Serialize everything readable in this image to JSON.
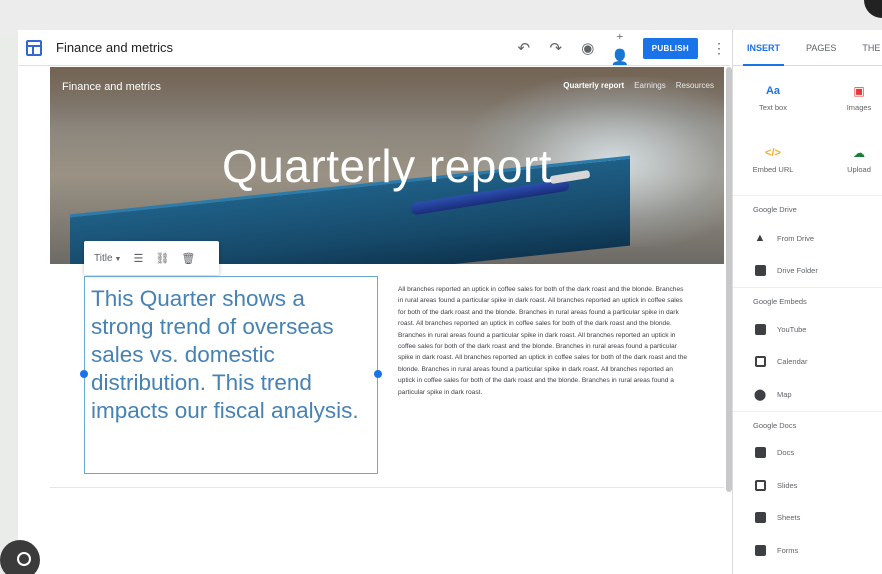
{
  "app": {
    "doc_title": "Finance and metrics",
    "publish_label": "PUBLISH"
  },
  "hero": {
    "site_title": "Finance and metrics",
    "nav": [
      "Quarterly report",
      "Earnings",
      "Resources"
    ],
    "heading": "Quarterly report"
  },
  "text_toolbar": {
    "style_value": "Title"
  },
  "text_box": {
    "content": "This Quarter shows a strong trend of overseas sales vs. domestic distribution.  This trend impacts our fiscal analysis."
  },
  "body_text": "All branches reported an uptick in coffee sales for both of the dark roast and the blonde.  Branches in rural areas found a particular spike in dark roast.  All branches reported an uptick in coffee sales for both of the dark roast and the blonde.  Branches in rural areas found a particular spike in dark roast.  All branches reported an uptick in coffee sales for both of the dark roast and the blonde.  Branches in rural areas found a particular spike in dark roast.  All branches reported an uptick in coffee sales for both of the dark roast and the blonde.  Branches in rural areas found a particular spike in dark roast.  All branches reported an uptick in coffee sales for both of the dark roast and the blonde.  Branches in rural areas found a particular spike in dark roast.  All branches reported an uptick in coffee sales for both of the dark roast and the blonde.  Branches in rural areas found a particular spike in dark roast.",
  "panel": {
    "tabs": [
      "INSERT",
      "PAGES",
      "THE"
    ],
    "insert_items": {
      "text_box": {
        "icon": "Aa",
        "label": "Text box"
      },
      "images": {
        "label": "Images"
      },
      "embed_url": {
        "icon": "</>",
        "label": "Embed URL"
      },
      "upload": {
        "label": "Upload"
      }
    },
    "drive": {
      "heading": "Google Drive",
      "items": [
        "From Drive",
        "Drive Folder"
      ]
    },
    "embeds": {
      "heading": "Google Embeds",
      "items": [
        "YouTube",
        "Calendar",
        "Map"
      ]
    },
    "docs": {
      "heading": "Google Docs",
      "items": [
        "Docs",
        "Slides",
        "Sheets",
        "Forms"
      ]
    }
  },
  "colors": {
    "accent": "#1a73e8",
    "title_text": "#4682b4",
    "hero_text": "#ffffff"
  }
}
